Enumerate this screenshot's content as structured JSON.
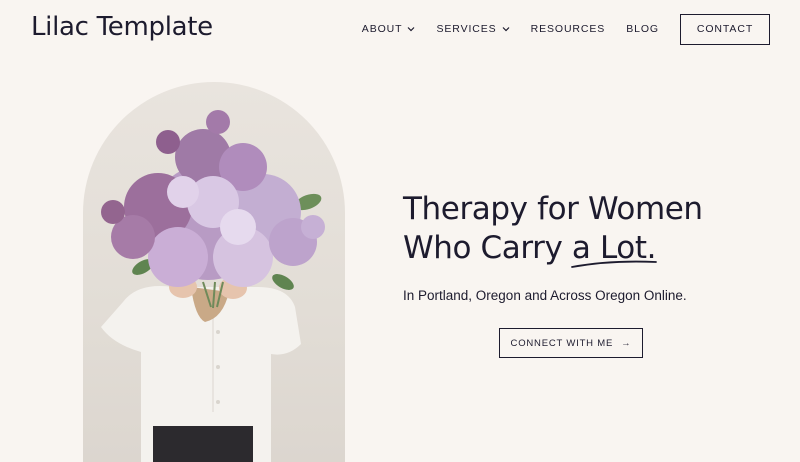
{
  "site": {
    "logo": "Lilac Template"
  },
  "nav": {
    "items": [
      {
        "label": "About",
        "dropdown": true
      },
      {
        "label": "Services",
        "dropdown": true
      },
      {
        "label": "Resources",
        "dropdown": false
      },
      {
        "label": "Blog",
        "dropdown": false
      }
    ],
    "contact_label": "Contact"
  },
  "hero": {
    "headline_line1": "Therapy for Women",
    "headline_line2_prefix": "Who Carry ",
    "headline_emphasis": "a Lot",
    "headline_suffix": ".",
    "subheadline": "In Portland, Oregon and Across Oregon Online.",
    "cta_label": "Connect with me",
    "cta_icon": "arrow-right-icon"
  },
  "colors": {
    "background": "#f9f5f1",
    "text": "#1d1b2e",
    "lilac": "#a883b0"
  }
}
